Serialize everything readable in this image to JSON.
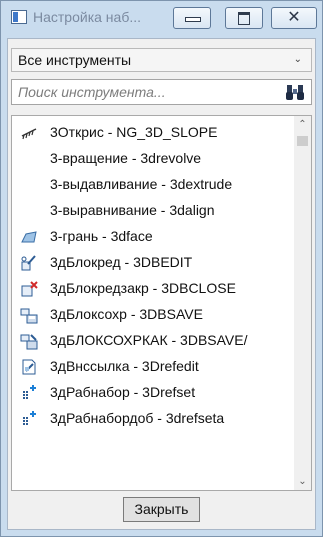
{
  "window": {
    "title": "Настройка наб..."
  },
  "filter": {
    "selected": "Все инструменты"
  },
  "search": {
    "placeholder": "Поиск инструмента..."
  },
  "tools": [
    {
      "label": "3Открис - NG_3D_SLOPE",
      "icon": "slope-icon"
    },
    {
      "label": "3-вращение - 3drevolve",
      "icon": ""
    },
    {
      "label": "3-выдавливание - 3dextrude",
      "icon": ""
    },
    {
      "label": "3-выравнивание - 3dalign",
      "icon": ""
    },
    {
      "label": "3-грань - 3dface",
      "icon": "3dface-icon"
    },
    {
      "label": "3дБлокред - 3DBEDIT",
      "icon": "block-edit-icon"
    },
    {
      "label": "3дБлокредзакр - 3DBCLOSE",
      "icon": "block-close-icon"
    },
    {
      "label": "3дБлоксохр - 3DBSAVE",
      "icon": "block-save-icon"
    },
    {
      "label": "3дБЛОКСОХРКАК - 3DBSAVE/",
      "icon": "block-save-as-icon"
    },
    {
      "label": "3дВнссылка - 3Drefedit",
      "icon": "xref-edit-icon"
    },
    {
      "label": "3дРабнабор - 3Drefset",
      "icon": "refset-add-icon"
    },
    {
      "label": "3дРабнабордоб - 3drefseta",
      "icon": "refset-add-icon"
    }
  ],
  "footer": {
    "close_label": "Закрыть"
  }
}
